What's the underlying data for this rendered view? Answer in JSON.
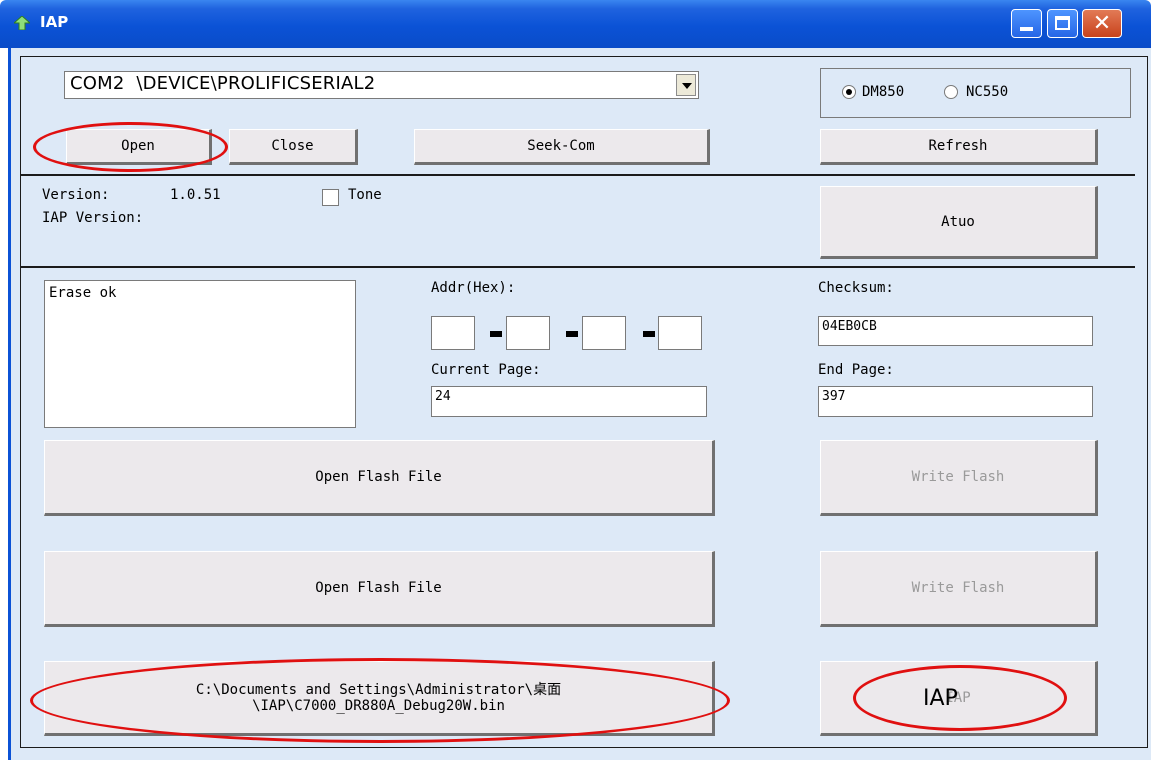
{
  "window": {
    "title": "IAP"
  },
  "port": {
    "selected": "COM2  \\DEVICE\\PROLIFICSERIAL2"
  },
  "model": {
    "options": [
      {
        "label": "DM850",
        "selected": true
      },
      {
        "label": "NC550",
        "selected": false
      }
    ]
  },
  "buttons": {
    "open": "Open",
    "close": "Close",
    "seek_com": "Seek-Com",
    "refresh": "Refresh",
    "auto": "Atuo",
    "open_flash_1": "Open Flash File",
    "write_flash_1": "Write Flash",
    "open_flash_2": "Open Flash File",
    "write_flash_2": "Write Flash",
    "file_path": "C:\\Documents and Settings\\Administrator\\桌面\n\\IAP\\C7000_DR880A_Debug20W.bin",
    "iap": "IAP"
  },
  "info": {
    "version_label": "Version:",
    "version_value": "1.0.51",
    "tone_label": "Tone",
    "tone_checked": false,
    "iap_version_label": "IAP Version:"
  },
  "log": {
    "text": "Erase ok"
  },
  "fields": {
    "addr_label": "Addr(Hex):",
    "addr_values": [
      "",
      "",
      "",
      ""
    ],
    "checksum_label": "Checksum:",
    "checksum_value": "04EB0CB",
    "current_page_label": "Current Page:",
    "current_page_value": "24",
    "end_page_label": "End Page:",
    "end_page_value": "397"
  },
  "annotation": {
    "iap_text": "IAP"
  },
  "colors": {
    "titlebar": "#0b52d6",
    "client_bg": "#dde9f7",
    "annotation": "#e01010"
  }
}
